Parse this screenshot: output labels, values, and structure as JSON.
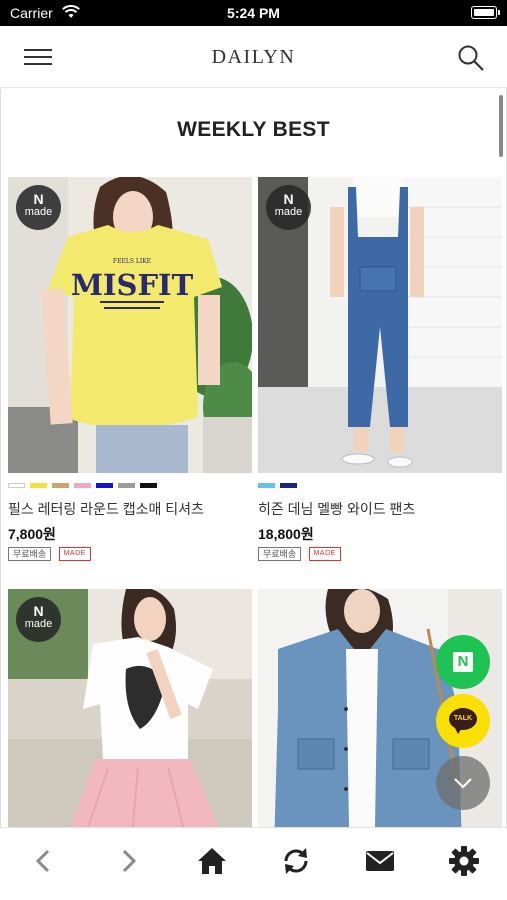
{
  "status_bar": {
    "carrier": "Carrier",
    "time": "5:24 PM"
  },
  "header": {
    "logo": "DAILYN",
    "menu_icon": "hamburger-menu-icon",
    "search_icon": "search-icon"
  },
  "section": {
    "title": "WEEKLY BEST"
  },
  "products": [
    {
      "badge_top": "N",
      "badge_bottom": "made",
      "name": "필스 레터링 라운드 캡소매 티셔츠",
      "price": "7,800원",
      "swatches": [
        "#ffffff",
        "#f4e23a",
        "#c9a66b",
        "#f2a6c4",
        "#1414c8",
        "#9a9a9a",
        "#111111"
      ],
      "tags": [
        "무료배송",
        "MADE"
      ],
      "image_text": {
        "small": "FEELS LIKE",
        "big": "MISFIT"
      }
    },
    {
      "badge_top": "N",
      "badge_bottom": "made",
      "name": "히즌 데님 멜빵 와이드 팬츠",
      "price": "18,800원",
      "swatches": [
        "#66c2e8",
        "#1a237e"
      ],
      "tags": [
        "무료배송",
        "MADE"
      ]
    },
    {
      "badge_top": "N",
      "badge_bottom": "made"
    },
    {}
  ],
  "floating": {
    "naver_label": "N",
    "talk_label": "TALK",
    "scroll_down_icon": "chevron-down-icon"
  },
  "toolbar": {
    "back_icon": "chevron-left-icon",
    "forward_icon": "chevron-right-icon",
    "home_icon": "home-icon",
    "refresh_icon": "refresh-icon",
    "mail_icon": "mail-icon",
    "settings_icon": "gear-icon"
  },
  "colors": {
    "accent_green": "#1fc353",
    "kakao_yellow": "#f9e000",
    "made_red": "#d33333"
  }
}
